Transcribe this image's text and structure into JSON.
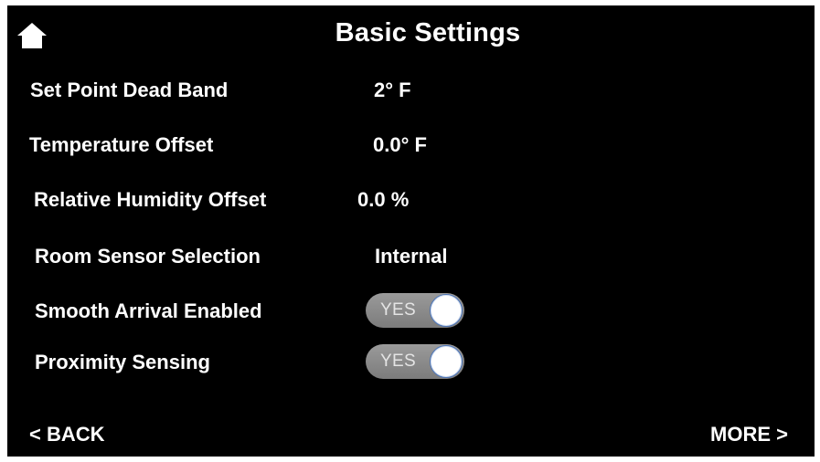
{
  "header": {
    "title": "Basic Settings",
    "home_icon": "home-icon"
  },
  "settings": [
    {
      "label": "Set Point Dead Band",
      "value": "2° F"
    },
    {
      "label": "Temperature Offset",
      "value": "0.0° F"
    },
    {
      "label": "Relative Humidity Offset",
      "value": "0.0 %"
    },
    {
      "label": "Room Sensor Selection",
      "value": "Internal"
    }
  ],
  "toggles": [
    {
      "label": "Smooth Arrival Enabled",
      "state_text": "YES",
      "on": true
    },
    {
      "label": "Proximity Sensing",
      "state_text": "YES",
      "on": true
    }
  ],
  "footer": {
    "back_label": "< BACK",
    "more_label": "MORE >"
  },
  "colors": {
    "background": "#000000",
    "text": "#ffffff",
    "toggle_track": "#8a8a8a",
    "toggle_knob_border": "#4b74b8"
  }
}
